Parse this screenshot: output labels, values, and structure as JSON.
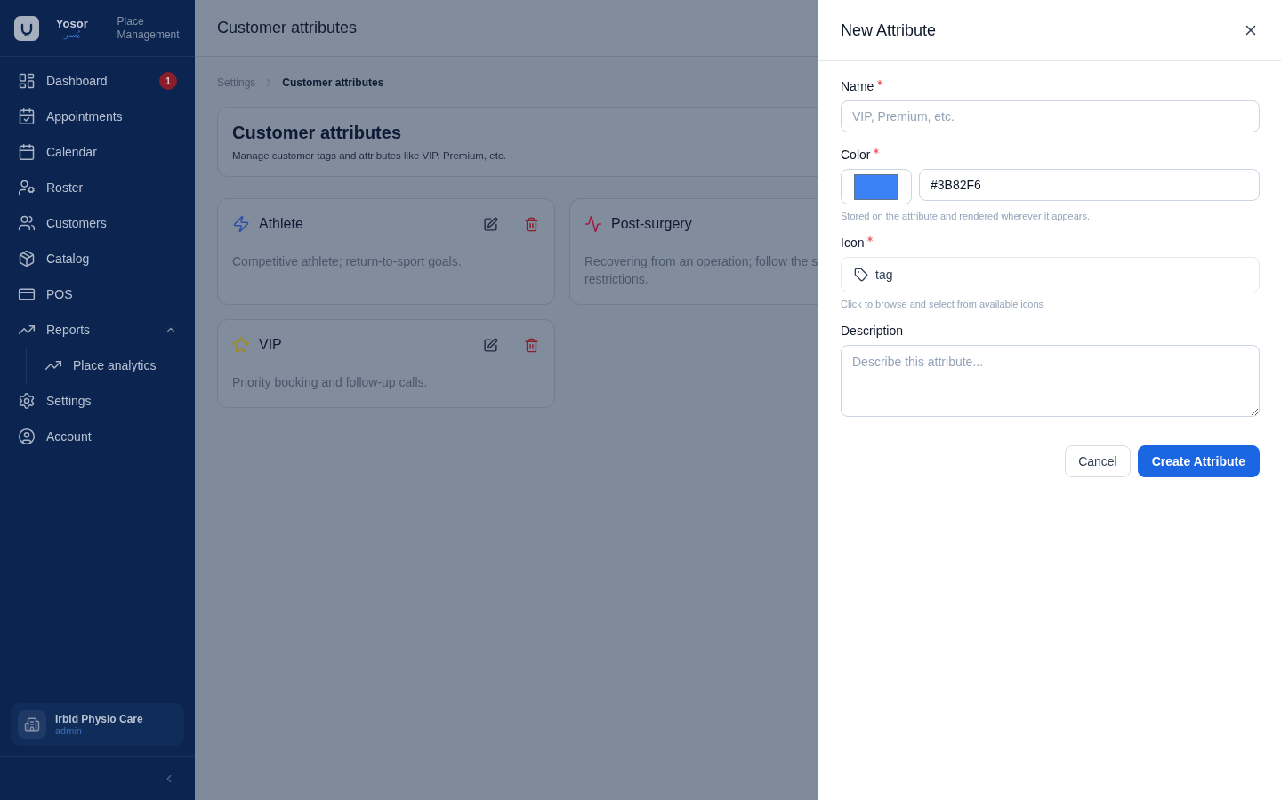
{
  "brand": {
    "name": "Yosor",
    "arabic_name": "يُسر",
    "subtitle": "Place Management"
  },
  "sidebar": {
    "items": [
      {
        "label": "Dashboard",
        "badge": "1"
      },
      {
        "label": "Appointments"
      },
      {
        "label": "Calendar"
      },
      {
        "label": "Roster"
      },
      {
        "label": "Customers"
      },
      {
        "label": "Catalog"
      },
      {
        "label": "POS"
      },
      {
        "label": "Reports",
        "expanded": true,
        "children": [
          {
            "label": "Place analytics"
          }
        ]
      },
      {
        "label": "Settings"
      },
      {
        "label": "Account"
      }
    ],
    "place": {
      "name": "Irbid Physio Care",
      "role": "admin"
    }
  },
  "header": {
    "title": "Customer attributes"
  },
  "breadcrumb": [
    "Settings",
    "Customer attributes"
  ],
  "page": {
    "title": "Customer attributes",
    "subtitle": "Manage customer tags and attributes like VIP, Premium, etc."
  },
  "attributes": [
    {
      "name": "Athlete",
      "color": "#2d4fa8",
      "description_lines": [
        "Competitive athlete; return-to-sport goals."
      ]
    },
    {
      "name": "Post-surgery",
      "color": "#9b1c3f",
      "description_lines": [
        "Recovering from an operation; follow the s",
        "restrictions."
      ]
    },
    {
      "name": "VIP",
      "color": "#a18b1a",
      "description_lines": [
        "Priority booking and follow-up calls."
      ]
    }
  ],
  "drawer": {
    "title": "New Attribute",
    "name_field": {
      "label": "Name",
      "required": true,
      "placeholder": "VIP, Premium, etc."
    },
    "color_field": {
      "label": "Color",
      "required": true,
      "color": "#3b82f6",
      "value": "#3B82F6",
      "hint": "Stored on the attribute and rendered wherever it appears."
    },
    "icon_field": {
      "label": "Icon",
      "required": true,
      "value": "tag",
      "hint": "Click to browse and select from available icons"
    },
    "description_field": {
      "label": "Description",
      "placeholder": "Describe this attribute..."
    },
    "buttons": [
      {
        "label": "Cancel",
        "kind": "secondary"
      },
      {
        "label": "Create Attribute",
        "kind": "primary"
      }
    ]
  }
}
